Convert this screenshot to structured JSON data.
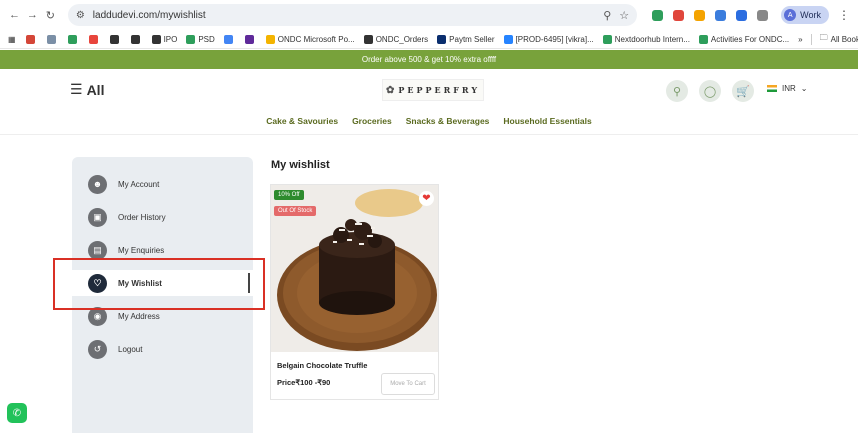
{
  "browser": {
    "url": "laddudevi.com/mywishlist",
    "profile_label": "Work",
    "profile_initial": "A",
    "bookmarks": [
      {
        "label": "",
        "color": "#d44638"
      },
      {
        "label": "",
        "color": "#7b8fa6"
      },
      {
        "label": "",
        "color": "#2e9e5b"
      },
      {
        "label": "",
        "color": "#e8453c"
      },
      {
        "label": "",
        "color": "#333333"
      },
      {
        "label": "",
        "color": "#333333"
      },
      {
        "label": "IPO",
        "color": "#333333"
      },
      {
        "label": "PSD",
        "color": "#2e9e5b"
      },
      {
        "label": "",
        "color": "#4285f4"
      },
      {
        "label": "",
        "color": "#5f2a9a"
      },
      {
        "label": "ONDC Microsoft Po...",
        "color": "#f4b400"
      },
      {
        "label": "ONDC_Orders",
        "color": "#333333"
      },
      {
        "label": "Paytm Seller",
        "color": "#0a2e6e"
      },
      {
        "label": "[PROD-6495] [vikra]...",
        "color": "#2684ff"
      },
      {
        "label": "Nextdoorhub Intern...",
        "color": "#2e9e5b"
      },
      {
        "label": "Activities For ONDC...",
        "color": "#2e9e5b"
      }
    ],
    "bookmarks_more": "»",
    "all_bookmarks": "All Bookmarks"
  },
  "site": {
    "promo": "Order above 500 & get 10% extra offff",
    "all_label": "All",
    "logo_text": "PEPPERFRY",
    "currency": "INR",
    "categories": [
      "Cake & Savouries",
      "Groceries",
      "Snacks & Beverages",
      "Household Essentials"
    ],
    "accent": "#78a23b"
  },
  "sidebar": {
    "items": [
      {
        "label": "My Account",
        "icon": "user-icon"
      },
      {
        "label": "Order History",
        "icon": "calendar-icon"
      },
      {
        "label": "My Enquiries",
        "icon": "list-icon"
      },
      {
        "label": "My Wishlist",
        "icon": "heart-icon",
        "active": true
      },
      {
        "label": "My Address",
        "icon": "location-icon"
      },
      {
        "label": "Logout",
        "icon": "logout-icon"
      }
    ]
  },
  "main": {
    "title": "My wishlist",
    "products": [
      {
        "name": "Belgain Chocolate Truffle",
        "price": "Price₹100 -₹90",
        "discount_badge": "10% Off",
        "stock_badge": "Out Of Stock",
        "action_label": "Move To Cart"
      }
    ]
  }
}
